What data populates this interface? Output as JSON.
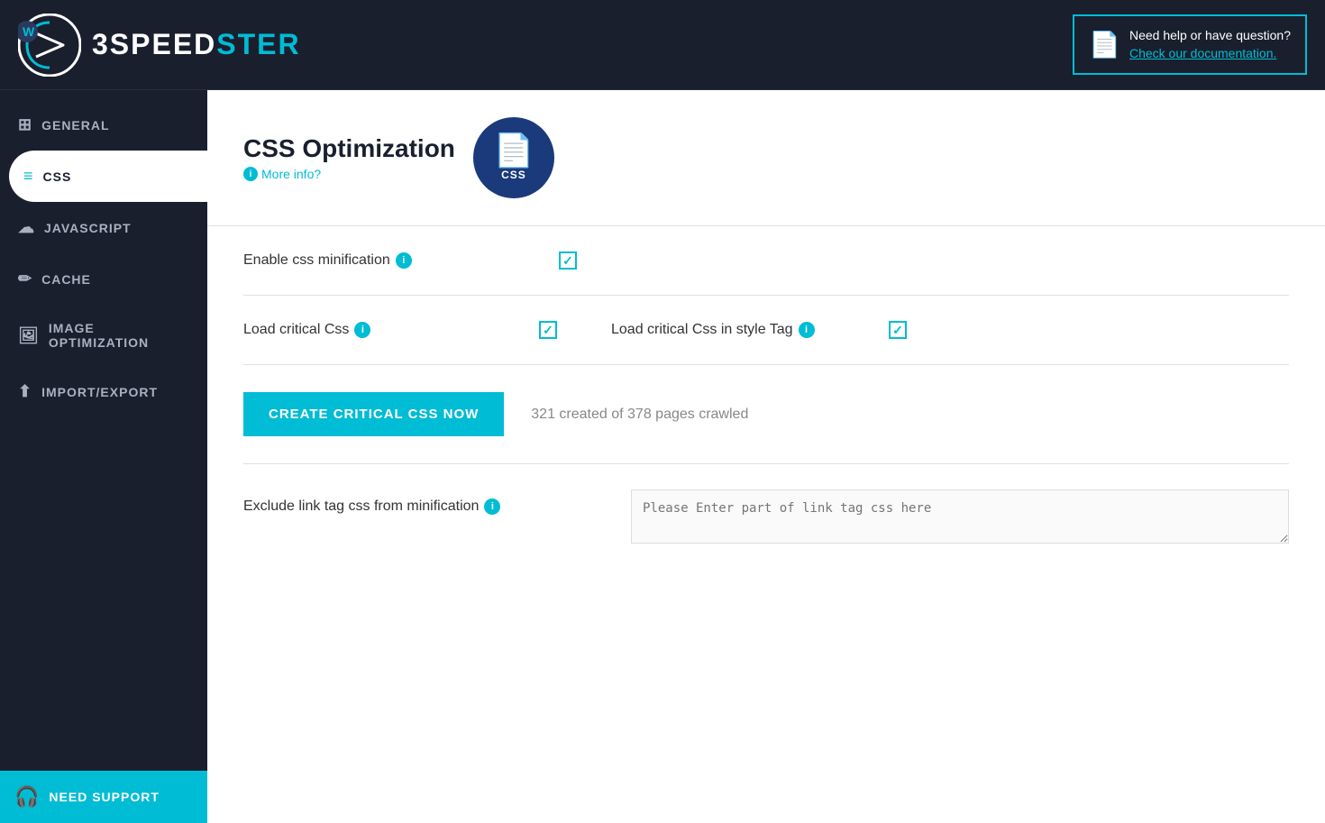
{
  "header": {
    "logo_three": "3",
    "logo_speed": "SPEED",
    "logo_ster": "STER",
    "help_question": "Need help or have question?",
    "help_link": "Check our documentation."
  },
  "sidebar": {
    "items": [
      {
        "id": "general",
        "label": "GENERAL",
        "icon": "⊞"
      },
      {
        "id": "css",
        "label": "CSS",
        "icon": "≡"
      },
      {
        "id": "javascript",
        "label": "JAVASCRIPT",
        "icon": "☁"
      },
      {
        "id": "cache",
        "label": "CACHE",
        "icon": "✏"
      },
      {
        "id": "image-optimization",
        "label": "IMAGE OPTIMIZATION",
        "icon": "🖼"
      },
      {
        "id": "import-export",
        "label": "IMPORT/EXPORT",
        "icon": "⬆"
      }
    ],
    "support": {
      "label": "NEED SUPPORT",
      "icon": "🎧"
    }
  },
  "main": {
    "page_title": "CSS Optimization",
    "more_info_label": "More info?",
    "settings": [
      {
        "id": "enable-css-minification",
        "label": "Enable css minification",
        "checked": true
      },
      {
        "id": "load-critical-css",
        "label": "Load critical Css",
        "checked": true,
        "secondary_label": "Load critical Css in style Tag",
        "secondary_checked": true
      }
    ],
    "button": {
      "label": "CREATE CRITICAL CSS NOW"
    },
    "crawl_info": "321 created of 378 pages crawled",
    "exclude": {
      "label": "Exclude link tag css from minification",
      "placeholder": "Please Enter part of link tag css here"
    }
  }
}
